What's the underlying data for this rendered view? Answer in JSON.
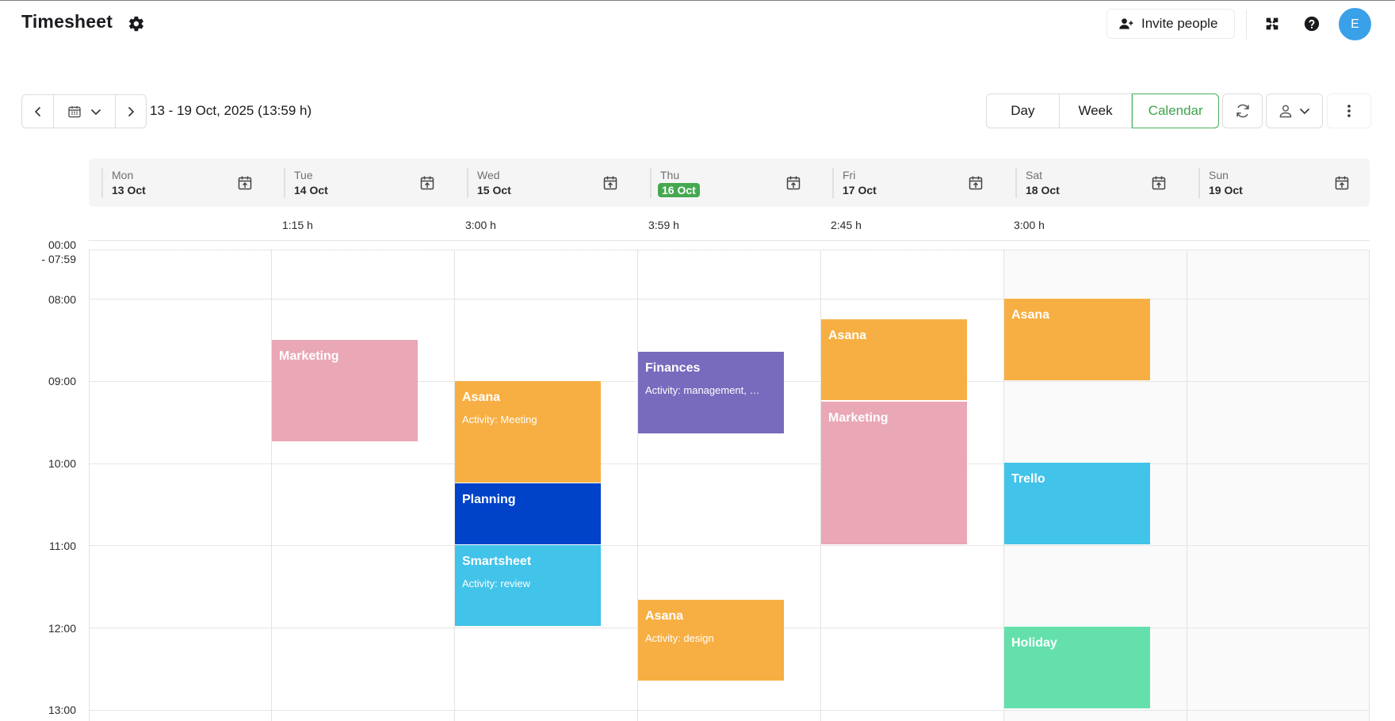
{
  "app": {
    "title": "Timesheet"
  },
  "header": {
    "invite_label": "Invite people",
    "avatar_initial": "E",
    "icons": [
      "gear-icon",
      "user-plus-icon",
      "puzzle-icon",
      "help-icon"
    ]
  },
  "toolbar": {
    "range_label": "13 - 19 Oct, 2025 (13:59 h)",
    "views": [
      "Day",
      "Week",
      "Calendar"
    ],
    "active_view": "Calendar"
  },
  "days": [
    {
      "name": "Mon",
      "date": "13 Oct",
      "total": ""
    },
    {
      "name": "Tue",
      "date": "14 Oct",
      "total": "1:15 h"
    },
    {
      "name": "Wed",
      "date": "15 Oct",
      "total": "3:00 h"
    },
    {
      "name": "Thu",
      "date": "16 Oct",
      "total": "3:59 h",
      "today": true
    },
    {
      "name": "Fri",
      "date": "17 Oct",
      "total": "2:45 h"
    },
    {
      "name": "Sat",
      "date": "18 Oct",
      "total": "3:00 h"
    },
    {
      "name": "Sun",
      "date": "19 Oct",
      "total": ""
    }
  ],
  "time_labels": {
    "early_top": "00:00",
    "early_bottom": "- 07:59",
    "hours": [
      "08:00",
      "09:00",
      "10:00",
      "11:00",
      "12:00",
      "13:00"
    ]
  },
  "events": [
    {
      "day": 1,
      "start": "08:30",
      "end": "09:45",
      "name": "Marketing",
      "activity": "",
      "color": "#eaa7b6"
    },
    {
      "day": 2,
      "start": "09:00",
      "end": "10:15",
      "name": "Asana",
      "activity": "Activity: Meeting",
      "color": "#f7af43"
    },
    {
      "day": 2,
      "start": "10:15",
      "end": "11:00",
      "name": "Planning",
      "activity": "",
      "color": "#0042c8"
    },
    {
      "day": 2,
      "start": "11:00",
      "end": "12:00",
      "name": "Smartsheet",
      "activity": "Activity: review",
      "color": "#42c3e9"
    },
    {
      "day": 3,
      "start": "08:39",
      "end": "09:39",
      "name": "Finances",
      "activity": "Activity: management, …",
      "color": "#786abd"
    },
    {
      "day": 3,
      "start": "11:40",
      "end": "12:40",
      "name": "Asana",
      "activity": "Activity: design",
      "color": "#f7af43"
    },
    {
      "day": 4,
      "start": "08:15",
      "end": "09:15",
      "name": "Asana",
      "activity": "",
      "color": "#f7af43"
    },
    {
      "day": 4,
      "start": "09:15",
      "end": "11:00",
      "name": "Marketing",
      "activity": "",
      "color": "#eaa7b6"
    },
    {
      "day": 5,
      "start": "08:00",
      "end": "09:00",
      "name": "Asana",
      "activity": "",
      "color": "#f7af43"
    },
    {
      "day": 5,
      "start": "10:00",
      "end": "11:00",
      "name": "Trello",
      "activity": "",
      "color": "#42c3e9"
    },
    {
      "day": 5,
      "start": "12:00",
      "end": "13:00",
      "name": "Holiday",
      "activity": "",
      "color": "#64e0ad"
    }
  ]
}
